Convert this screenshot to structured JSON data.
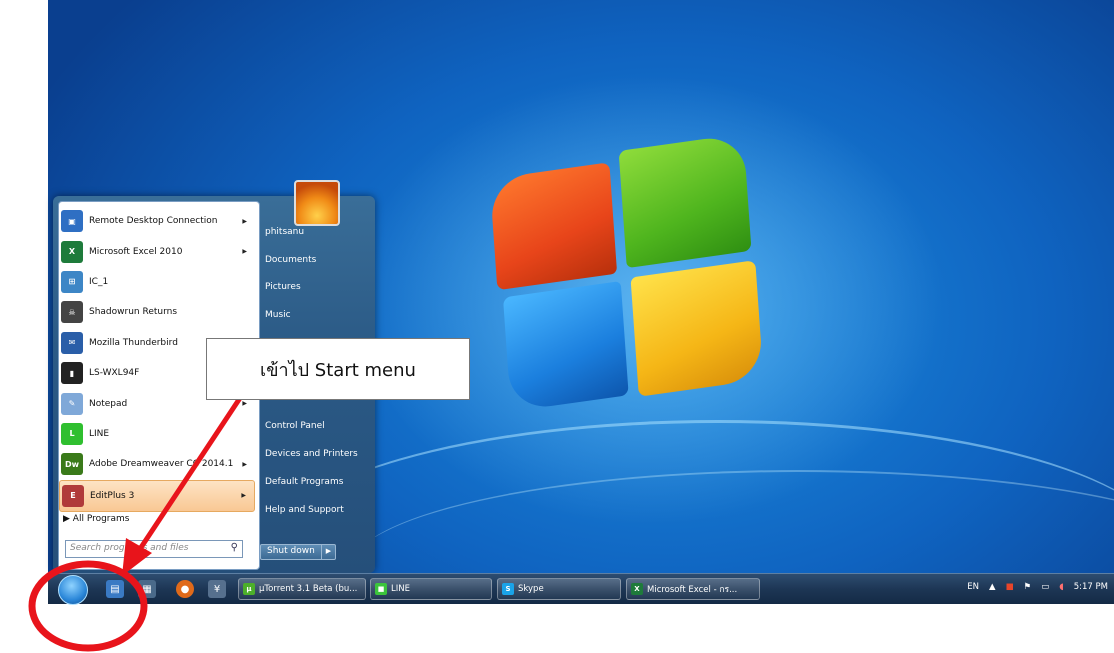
{
  "start_menu": {
    "programs": [
      {
        "label": "Remote Desktop Connection",
        "icon": "remote-desktop-icon",
        "has_arrow": true
      },
      {
        "label": "Microsoft Excel 2010",
        "icon": "excel-icon",
        "has_arrow": true
      },
      {
        "label": "IC_1",
        "icon": "ic-icon",
        "has_arrow": false
      },
      {
        "label": "Shadowrun Returns",
        "icon": "shadowrun-icon",
        "has_arrow": false
      },
      {
        "label": "Mozilla Thunderbird",
        "icon": "thunderbird-icon",
        "has_arrow": false
      },
      {
        "label": "LS-WXL94F",
        "icon": "nas-icon",
        "has_arrow": false
      },
      {
        "label": "Notepad",
        "icon": "notepad-icon",
        "has_arrow": true
      },
      {
        "label": "LINE",
        "icon": "line-icon",
        "has_arrow": false
      },
      {
        "label": "Adobe Dreamweaver CC 2014.1",
        "icon": "dreamweaver-icon",
        "has_arrow": true
      },
      {
        "label": "EditPlus 3",
        "icon": "editplus-icon",
        "has_arrow": true
      }
    ],
    "all_programs": "All Programs",
    "search_placeholder": "Search programs and files",
    "user": "phitsanu",
    "places": [
      "phitsanu",
      "Documents",
      "Pictures",
      "Music",
      "",
      "",
      "",
      "Control Panel",
      "Devices and Printers",
      "Default Programs",
      "Help and Support"
    ],
    "shutdown_label": "Shut down"
  },
  "taskbar": {
    "tasks": [
      {
        "label": "µTorrent 3.1 Beta (bu...",
        "icon": "utorrent-icon"
      },
      {
        "label": "LINE",
        "icon": "line-icon"
      },
      {
        "label": "Skype",
        "icon": "skype-icon"
      },
      {
        "label": "Microsoft Excel - กร...",
        "icon": "excel-icon"
      }
    ],
    "tray": {
      "lang": "EN",
      "time": "5:17 PM"
    }
  },
  "callout": {
    "text": "เข้าไป Start menu"
  },
  "colors": {
    "annotation_red": "#e8141b",
    "desktop_blue": "#1d8ee0"
  }
}
